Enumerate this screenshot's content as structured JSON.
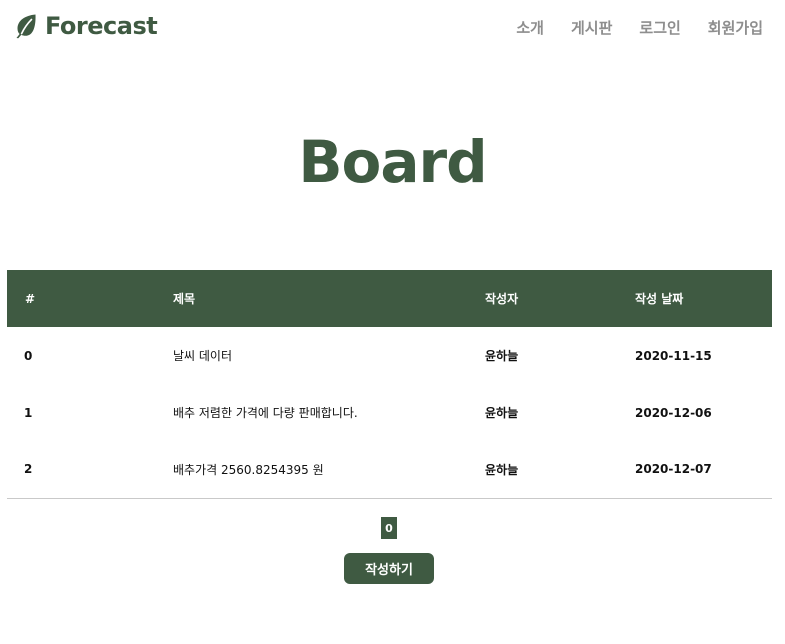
{
  "brand": {
    "name": "Forecast",
    "icon": "leaf-icon",
    "color": "#3f5a42"
  },
  "nav": {
    "items": [
      {
        "label": "소개"
      },
      {
        "label": "게시판"
      },
      {
        "label": "로그인"
      },
      {
        "label": "회원가입"
      }
    ]
  },
  "page": {
    "title": "Board"
  },
  "table": {
    "headers": [
      "#",
      "제목",
      "작성자",
      "작성 날짜"
    ],
    "rows": [
      {
        "num": "0",
        "title": "날씨 데이터",
        "author": "윤하늘",
        "date": "2020-11-15"
      },
      {
        "num": "1",
        "title": "배추 저렴한 가격에 다량 판매합니다.",
        "author": "윤하늘",
        "date": "2020-12-06"
      },
      {
        "num": "2",
        "title": "배추가격 2560.8254395 원",
        "author": "윤하늘",
        "date": "2020-12-07"
      }
    ]
  },
  "pagination": {
    "current": "0"
  },
  "actions": {
    "write_label": "작성하기"
  },
  "colors": {
    "accent": "#3f5a42",
    "nav_text": "#8e8e8e"
  }
}
